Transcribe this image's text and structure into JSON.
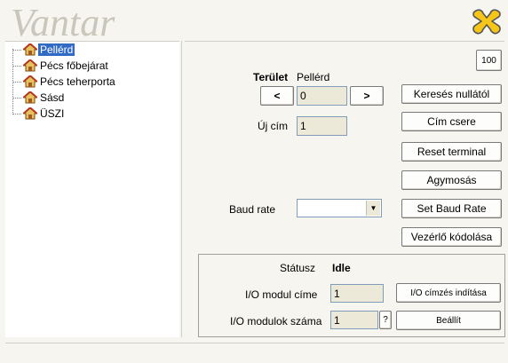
{
  "app": {
    "logo_text": "Vantar"
  },
  "tree": {
    "items": [
      {
        "label": "Pellérd",
        "selected": true
      },
      {
        "label": "Pécs főbejárat",
        "selected": false
      },
      {
        "label": "Pécs teherporta",
        "selected": false
      },
      {
        "label": "Sásd",
        "selected": false
      },
      {
        "label": "ÜSZI",
        "selected": false
      }
    ]
  },
  "main": {
    "corner_badge": "100",
    "terulet_label": "Terület",
    "terulet_value": "Pellérd",
    "prev_label": "<",
    "next_label": ">",
    "address_value": "0",
    "uj_cim_label": "Új cím",
    "uj_cim_value": "1",
    "baud_rate_label": "Baud rate",
    "baud_rate_value": ""
  },
  "actions": {
    "search_from_zero": "Keresés nullától",
    "address_change": "Cím csere",
    "reset_terminal": "Reset terminal",
    "agymosas": "Agymosás",
    "set_baud_rate": "Set Baud Rate",
    "controller_encode": "Vezérlő kódolása"
  },
  "status": {
    "status_label": "Státusz",
    "status_value": "Idle",
    "io_module_address_label": "I/O modul címe",
    "io_module_address_value": "1",
    "io_start_addressing": "I/O címzés indítása",
    "io_module_count_label": "I/O modulok száma",
    "io_module_count_value": "1",
    "help_label": "?",
    "set_label": "Beállít"
  },
  "colors": {
    "selection": "#316ac5",
    "window_bg": "#f6f5ef",
    "close_icon": "#f0c020"
  }
}
